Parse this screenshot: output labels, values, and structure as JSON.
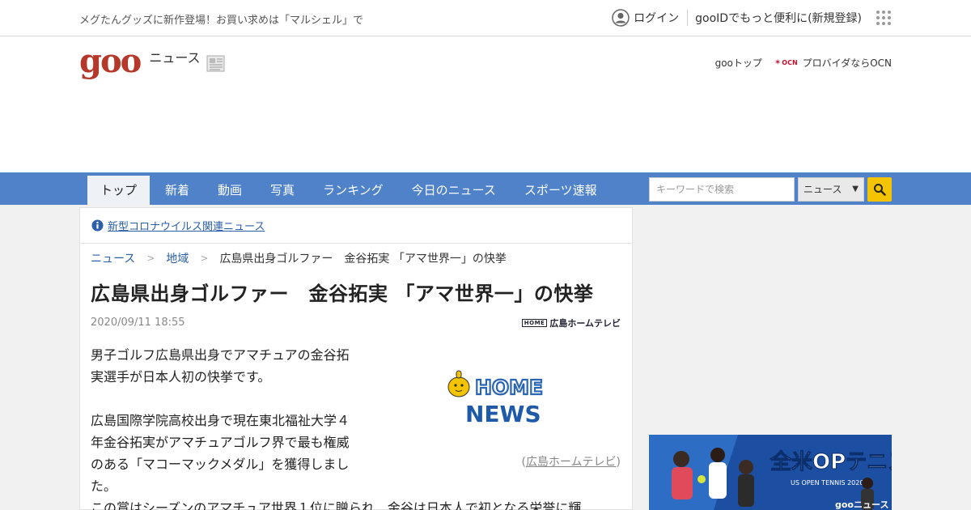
{
  "topbar": {
    "promo": "メグたんグッズに新作登場！お買い求めは「マルシェル」で",
    "login": "ログイン",
    "register": "gooIDでもっと便利に(新規登録)"
  },
  "header": {
    "logo": "goo",
    "section": "ニュース",
    "links": {
      "gootop": "gooトップ",
      "ocn_logo": "OCN",
      "ocn_label": "プロバイダならOCN"
    }
  },
  "nav": {
    "tabs": [
      {
        "label": "トップ",
        "active": true
      },
      {
        "label": "新着"
      },
      {
        "label": "動画"
      },
      {
        "label": "写真"
      },
      {
        "label": "ランキング"
      },
      {
        "label": "今日のニュース"
      },
      {
        "label": "スポーツ速報"
      }
    ],
    "search_placeholder": "キーワードで検索",
    "search_scope": "ニュース"
  },
  "article": {
    "notice": "新型コロナウイルス関連ニュース",
    "breadcrumb": [
      "ニュース",
      "地域",
      "広島県出身ゴルファー　金谷拓実 「アマ世界一」の快挙"
    ],
    "title": "広島県出身ゴルファー　金谷拓実 「アマ世界一」の快挙",
    "date": "2020/09/11 18:55",
    "source_logo": "広島ホームテレビ",
    "source_logo_mini": "HOME",
    "paragraphs": [
      [
        "男子ゴルフ広島県出身でアマチュアの金谷拓",
        "実選手が日本人初の快挙です。"
      ],
      [
        "広島国際学院高校出身で現在東北福祉大学４",
        "年金谷拓実がアマチュアゴルフ界で最も権威",
        "のある「マコーマックメダル」を獲得しまし",
        "た。"
      ]
    ],
    "wide_line": "この賞はシーズンのアマチュア世界１位に贈られ　金谷は日本人で初となる栄誉に輝",
    "image": {
      "line1": "HOME",
      "line2": "NEWS"
    },
    "caption_open": "(",
    "caption_link": "広島ホームテレビ",
    "caption_close": ")"
  },
  "ad": {
    "title": "全米OPテニス",
    "subtitle": "US OPEN TENNIS 2020",
    "brand": "gooニュース"
  },
  "colors": {
    "nav": "#4f82c9",
    "logo": "#b5382b",
    "link": "#2b5fa8",
    "search_button": "#f5c400"
  }
}
